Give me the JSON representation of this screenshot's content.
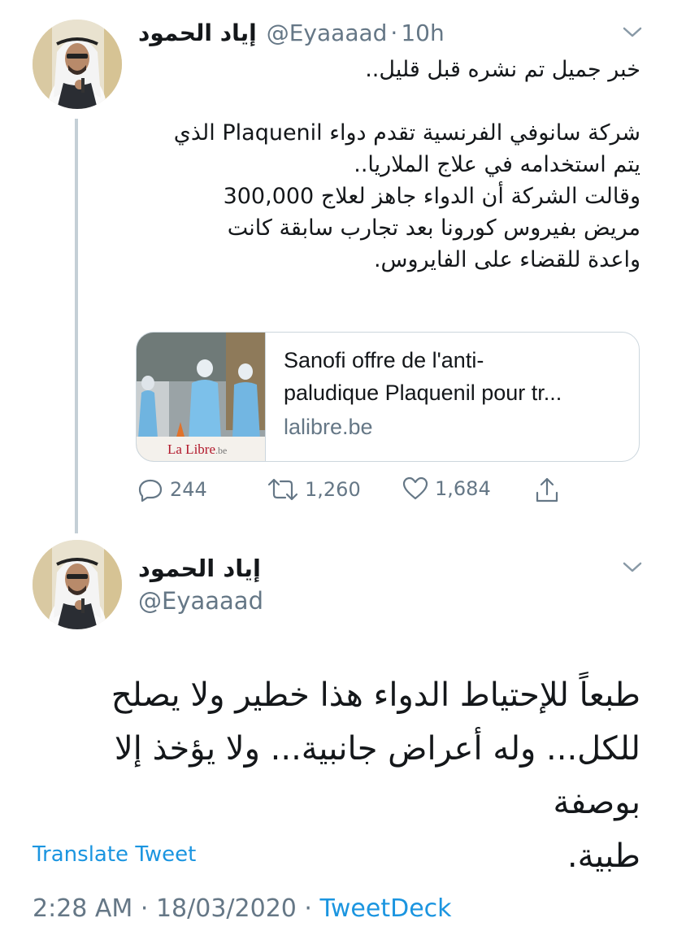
{
  "tweet1": {
    "name": "إياد الحمود",
    "handle": "@Eyaaaad",
    "separator": "·",
    "time": "10h",
    "lines": [
      "خبر جميل تم نشره قبل قليل..",
      "",
      "شركة سانوفي الفرنسية تقدم دواء Plaquenil الذي",
      "يتم استخدامه في علاج الملاريا..",
      "وقالت الشركة أن الدواء جاهز لعلاج 300,000",
      "مريض بفيروس كورونا بعد تجارب سابقة كانت",
      "واعدة للقضاء على الفايروس."
    ],
    "card": {
      "title": "Sanofi offre de l'anti-paludique Plaquenil pour tr...",
      "title_line1": "Sanofi offre de l'anti-",
      "title_line2": "paludique Plaquenil pour tr...",
      "domain": "lalibre.be",
      "thumb_logo": "La Libre",
      "thumb_logo_suffix": ".be"
    },
    "actions": {
      "replies": "244",
      "retweets": "1,260",
      "likes": "1,684"
    },
    "icons": {
      "reply": "reply-icon",
      "retweet": "retweet-icon",
      "like": "heart-icon",
      "share": "share-icon",
      "menu": "chevron-down-icon"
    }
  },
  "tweet2": {
    "name": "إياد الحمود",
    "handle": "@Eyaaaad",
    "lines": [
      "طبعاً للإحتياط الدواء هذا خطير ولا يصلح",
      "للكل... وله أعراض جانبية... ولا يؤخذ إلا بوصفة",
      "طبية."
    ],
    "translate": "Translate Tweet",
    "timestamp": "2:28 AM",
    "date": "18/03/2020",
    "separator": "·",
    "via": "TweetDeck"
  },
  "colors": {
    "link": "#1b95e0",
    "muted": "#657786",
    "text": "#14171a",
    "border": "#ccd6dd",
    "thread_line": "#c4cfd6"
  }
}
